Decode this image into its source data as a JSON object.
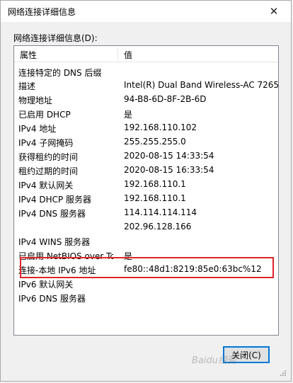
{
  "window": {
    "title": "网络连接详细信息",
    "close_glyph": "✕"
  },
  "details": {
    "group_label": "网络连接详细信息(D):",
    "columns": [
      "属性",
      "值"
    ],
    "rows": [
      {
        "property": "连接特定的 DNS 后缀",
        "value": ""
      },
      {
        "property": "描述",
        "value": "Intel(R) Dual Band Wireless-AC 7265"
      },
      {
        "property": "物理地址",
        "value": "94-B8-6D-8F-2B-6D"
      },
      {
        "property": "已启用 DHCP",
        "value": "是"
      },
      {
        "property": "IPv4 地址",
        "value": "192.168.110.102"
      },
      {
        "property": "IPv4 子网掩码",
        "value": "255.255.255.0"
      },
      {
        "property": "获得租约的时间",
        "value": "2020-08-15 14:33:54"
      },
      {
        "property": "租约过期的时间",
        "value": "2020-08-15 16:33:54"
      },
      {
        "property": "IPv4 默认网关",
        "value": "192.168.110.1"
      },
      {
        "property": "IPv4 DHCP 服务器",
        "value": "192.168.110.1"
      },
      {
        "property": "IPv4 DNS 服务器",
        "value": "114.114.114.114"
      },
      {
        "property": "",
        "value": "202.96.128.166"
      },
      {
        "property": "IPv4 WINS 服务器",
        "value": ""
      },
      {
        "property": "已启用 NetBIOS over Tc...",
        "value": "是"
      },
      {
        "property": "连接-本地 IPv6 地址",
        "value": "fe80::48d1:8219:85e0:63bc%12"
      },
      {
        "property": "IPv6 默认网关",
        "value": ""
      },
      {
        "property": "IPv6 DNS 服务器",
        "value": ""
      }
    ]
  },
  "buttons": {
    "close_label": "关闭(C)"
  },
  "watermark": {
    "text": "Baidu经验"
  },
  "colors": {
    "highlight": "#e0242a",
    "focus": "#0078d7"
  }
}
